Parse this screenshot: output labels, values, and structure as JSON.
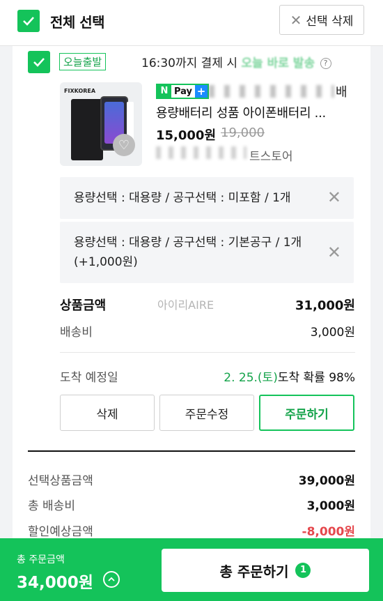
{
  "header": {
    "select_all_label": "전체 선택",
    "delete_selected_label": "선택 삭제"
  },
  "shipping": {
    "badge": "오늘출발",
    "text_prefix": "16:30까지 결제 시 ",
    "text_highlight": "오늘 바로 발송"
  },
  "product": {
    "image_brand": "FIXKOREA",
    "npay_n": "N",
    "npay_label": "Pay",
    "npay_plus": "+",
    "seller_suffix": "배",
    "name": "용량배터리 성품 아이폰배터리 ...",
    "price": "15,000원",
    "old_price": "19,000",
    "store_suffix": "트스토어"
  },
  "options": [
    {
      "text": "용량선택 : 대용량 / 공구선택 : 미포함 / 1개"
    },
    {
      "text": "용량선택 : 대용량 / 공구선택 : 기본공구 / 1개 (+1,000원)"
    }
  ],
  "summary_item": {
    "subtotal_label": "상품금액",
    "subtotal_value": "31,000원",
    "watermark": "아이리AIRE",
    "shipping_label": "배송비",
    "shipping_value": "3,000원",
    "arrival_label": "도착 예정일",
    "arrival_date": "2. 25.(토)",
    "arrival_suffix": "도착 확률 98%"
  },
  "actions": {
    "delete": "삭제",
    "edit": "주문수정",
    "order": "주문하기"
  },
  "totals": {
    "selected_label": "선택상품금액",
    "selected_value": "39,000원",
    "shipping_label": "총 배송비",
    "shipping_value": "3,000원",
    "discount_label": "할인예상금액",
    "discount_value": "-8,000원"
  },
  "footer": {
    "total_label": "총 주문금액",
    "total_value": "34,000원",
    "order_all_label": "총 주문하기",
    "count": "1"
  },
  "colors": {
    "accent": "#14c35a",
    "discount": "#e5484d"
  },
  "icons": [
    "check-icon",
    "close-icon",
    "question-icon",
    "heart-icon",
    "chevron-up-icon"
  ]
}
